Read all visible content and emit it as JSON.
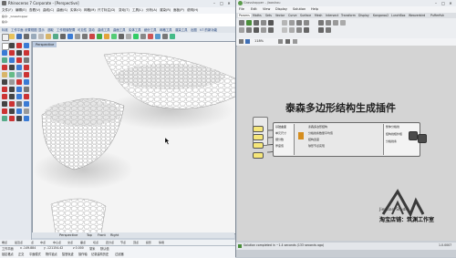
{
  "rhino": {
    "title": "Rhinoceros 7 Corporate - [Perspective]",
    "menu": [
      "文件(F)",
      "编辑(E)",
      "查看(V)",
      "曲线(C)",
      "曲面(S)",
      "实体(O)",
      "网格(M)",
      "尺寸标注(D)",
      "变动(T)",
      "工具(L)",
      "分析(A)",
      "渲染(R)",
      "面板(P)",
      "说明(H)"
    ],
    "command_lines": [
      "指令: _Grasshopper",
      "指令:"
    ],
    "tabs": [
      "标准",
      "工作平面",
      "设置视图",
      "显示",
      "选取",
      "工作视窗配置",
      "可见性",
      "变动",
      "曲线工具",
      "曲面工具",
      "实体工具",
      "细分工具",
      "网格工具",
      "渲染工具",
      "出图",
      "V7 的新功能"
    ],
    "viewport_label": "Perspective",
    "view_tabs": [
      "Perspective",
      "Top",
      "Front",
      "Right"
    ],
    "osnaps": [
      "端点",
      "最近点",
      "点",
      "中点",
      "中心点",
      "交点",
      "垂点",
      "切点",
      "四分点",
      "节点",
      "顶点",
      "投影",
      "停用"
    ],
    "status": {
      "plane": "工作平面",
      "x": "x -149.884",
      "y": "y -121154.42",
      "z": "z 0.000",
      "unit": "毫米",
      "layer": "默认值",
      "items": [
        "锁定格点",
        "正交",
        "平面模式",
        "物件锁点",
        "智慧轨迹",
        "操作轴",
        "记录建构历史",
        "过滤器"
      ]
    }
  },
  "grasshopper": {
    "title": "Grasshopper - jiaoshou",
    "menu": [
      "File",
      "Edit",
      "View",
      "Display",
      "Solution",
      "Help"
    ],
    "tabs": [
      "Params",
      "Maths",
      "Sets",
      "Vector",
      "Curve",
      "Surface",
      "Mesh",
      "Intersect",
      "Transform",
      "Display",
      "Kangaroo2",
      "LunchBox",
      "Weaverbird",
      "Pufferfish"
    ],
    "zoom": "118%",
    "heading": "泰森多边形结构生成插件",
    "node_labels": {
      "inputs": [
        "基础曲面",
        "单元尺寸",
        "细分数",
        "厚度值"
      ],
      "center": [
        "泰森多边形结构",
        "分格线条数量平均值",
        "结构宽度",
        "球形节点实现"
      ],
      "outputs": [
        "整体分格线",
        "结构线框外框",
        "分格线条"
      ]
    },
    "slider_labels": [
      "0.5",
      "10",
      "3"
    ],
    "status": "Solution completed in ~1.4 seconds (133 seconds ago)",
    "status_right": "1.0.0007"
  },
  "logo": {
    "brand": "Jieyuan-Studio",
    "credit": "淘宝店铺：筑渊工作室"
  }
}
